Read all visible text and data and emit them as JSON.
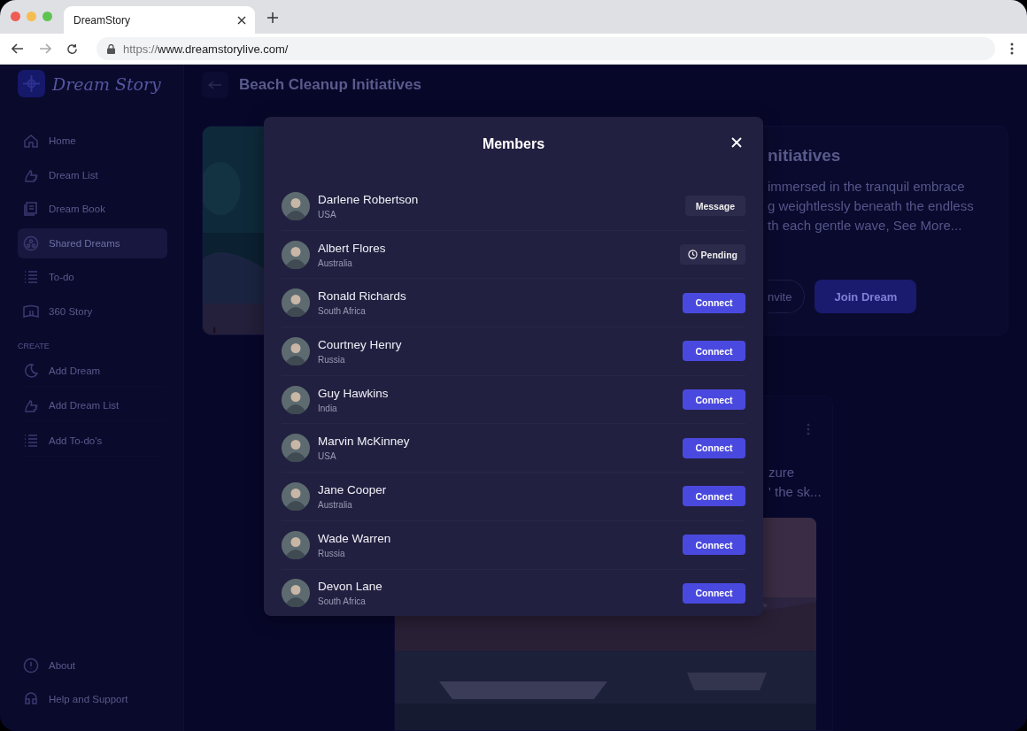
{
  "browser": {
    "tab_title": "DreamStory",
    "url_prefix": "https://",
    "url_host": "www.dreamstorylive.com/"
  },
  "sidebar": {
    "logo": "Dream Story",
    "items": [
      {
        "label": "Home",
        "selected": false
      },
      {
        "label": "Dream List",
        "selected": false
      },
      {
        "label": "Dream Book",
        "selected": false
      },
      {
        "label": "Shared Dreams",
        "selected": true
      },
      {
        "label": "To-do",
        "selected": false
      },
      {
        "label": "360 Story",
        "selected": false
      }
    ],
    "section": "CREATE",
    "create_items": [
      {
        "label": "Add Dream"
      },
      {
        "label": "Add Dream List"
      },
      {
        "label": "Add To-do's"
      }
    ],
    "footer_items": [
      {
        "label": "About"
      },
      {
        "label": "Help and Support"
      }
    ]
  },
  "header": {
    "title": "Beach Cleanup Initiatives"
  },
  "dream_card": {
    "title": "nitiatives",
    "description_lines": [
      "immersed in the tranquil embrace",
      "g weightlessly beneath the endless",
      "th each gentle wave, See More..."
    ],
    "invite_button": "nvite",
    "join_button": "Join Dream"
  },
  "second_card": {
    "description_lines": [
      "zure",
      "' the sk..."
    ]
  },
  "modal": {
    "title": "Members",
    "members": [
      {
        "name": "Darlene Robertson",
        "country": "USA",
        "kind": "message",
        "action": "Message"
      },
      {
        "name": "Albert Flores",
        "country": "Australia",
        "kind": "pending",
        "action": "Pending"
      },
      {
        "name": "Ronald Richards",
        "country": "South Africa",
        "kind": "connect",
        "action": "Connect"
      },
      {
        "name": "Courtney Henry",
        "country": "Russia",
        "kind": "connect",
        "action": "Connect"
      },
      {
        "name": "Guy Hawkins",
        "country": "India",
        "kind": "connect",
        "action": "Connect"
      },
      {
        "name": "Marvin McKinney",
        "country": "USA",
        "kind": "connect",
        "action": "Connect"
      },
      {
        "name": "Jane Cooper",
        "country": "Australia",
        "kind": "connect",
        "action": "Connect"
      },
      {
        "name": "Wade Warren",
        "country": "Russia",
        "kind": "connect",
        "action": "Connect"
      },
      {
        "name": "Devon Lane",
        "country": "South Africa",
        "kind": "connect",
        "action": "Connect"
      }
    ]
  }
}
